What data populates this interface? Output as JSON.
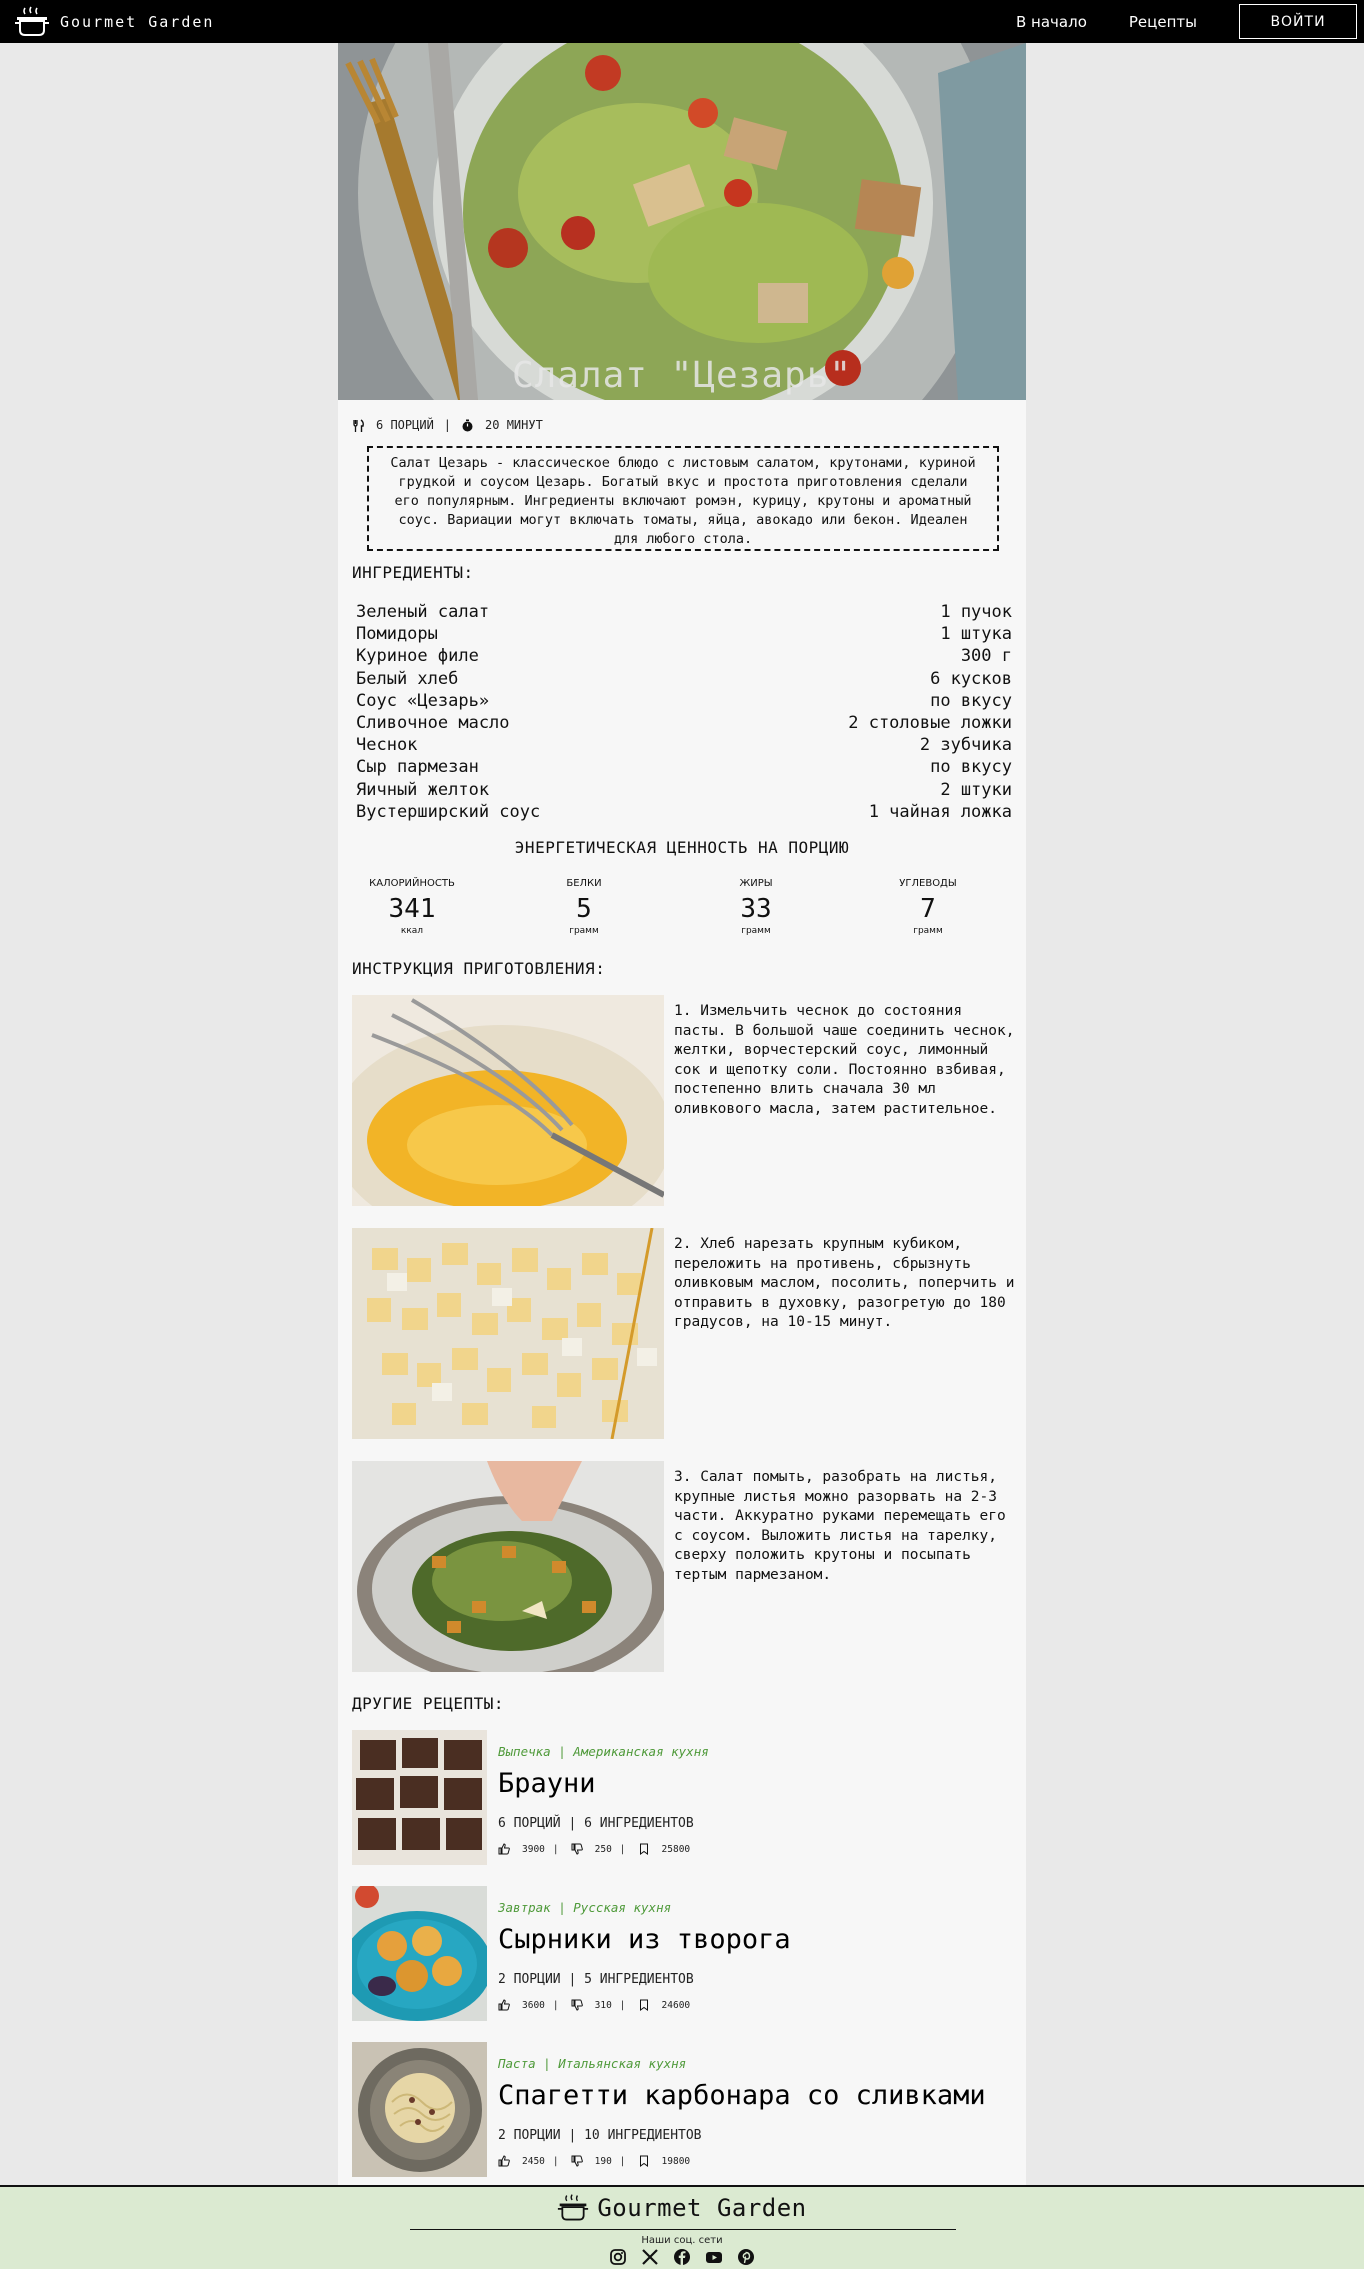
{
  "header": {
    "brand": "Gourmet Garden",
    "nav": [
      {
        "label": "В начало"
      },
      {
        "label": "Рецепты"
      }
    ],
    "login": "ВОЙТИ"
  },
  "recipe": {
    "title": "Слалат \"Цезарь\"",
    "servings": "6 ПОРЦИЙ",
    "separator": "|",
    "time": "20 МИНУТ",
    "description": "Салат Цезарь - классическое блюдо с листовым салатом, крутонами, куриной грудкой и соусом Цезарь. Богатый вкус и простота приготовления сделали его популярным. Ингредиенты включают ромэн, курицу, крутоны и ароматный соус. Вариации могут включать томаты, яйца, авокадо или бекон. Идеален для любого стола."
  },
  "ingredients_heading": "ИНГРЕДИЕНТЫ:",
  "ingredients": [
    {
      "name": "Зеленый салат",
      "amount": "1 пучок"
    },
    {
      "name": "Помидоры",
      "amount": "1 штука"
    },
    {
      "name": "Куриное филе",
      "amount": "300 г"
    },
    {
      "name": "Белый хлеб",
      "amount": "6 кусков"
    },
    {
      "name": "Соус «Цезарь»",
      "amount": "по вкусу"
    },
    {
      "name": "Сливочное масло",
      "amount": "2 столовые ложки"
    },
    {
      "name": "Чеснок",
      "amount": "2 зубчика"
    },
    {
      "name": "Сыр пармезан",
      "amount": "по вкусу"
    },
    {
      "name": "Яичный желток",
      "amount": "2 штуки"
    },
    {
      "name": "Вустерширский соус",
      "amount": "1 чайная ложка"
    }
  ],
  "nutrition": {
    "title": "ЭНЕРГЕТИЧЕСКАЯ ЦЕННОСТЬ НА ПОРЦИЮ",
    "items": [
      {
        "label": "КАЛОРИЙНОСТЬ",
        "value": "341",
        "unit": "ккал"
      },
      {
        "label": "БЕЛКИ",
        "value": "5",
        "unit": "грамм"
      },
      {
        "label": "ЖИРЫ",
        "value": "33",
        "unit": "грамм"
      },
      {
        "label": "УГЛЕВОДЫ",
        "value": "7",
        "unit": "грамм"
      }
    ]
  },
  "instructions_heading": "ИНСТРУКЦИЯ ПРИГОТОВЛЕНИЯ:",
  "steps": [
    {
      "text": "1. Измельчить чеснок до состояния пасты. В большой чаше соединить чеснок, желтки, ворчестерский соус, лимонный сок и щепотку соли. Постоянно взбивая, постепенно влить сначала 30 мл оливкового масла, затем растительное."
    },
    {
      "text": "2. Хлеб нарезать крупным кубиком, переложить на противень, сбрызнуть оливковым маслом, посолить, поперчить и отправить в духовку, разогретую до 180 градусов, на 10-15 минут."
    },
    {
      "text": "3. Салат помыть, разобрать на листья, крупные листья можно разорвать на 2-3 части. Аккуратно руками перемещать его с соусом. Выложить листья на тарелку, сверху положить крутоны и посыпать тертым пармезаном."
    }
  ],
  "other_heading": "ДРУГИЕ РЕЦЕПТЫ:",
  "other_recipes": [
    {
      "category": "Выпечка",
      "cuisine": "Американская кухня",
      "name": "Брауни",
      "servings": "6 ПОРЦИЙ",
      "ingredients": "6 ИНГРЕДИЕНТОВ",
      "likes": "3900",
      "dislikes": "250",
      "saves": "25800"
    },
    {
      "category": "Завтрак",
      "cuisine": "Русская кухня",
      "name": "Сырники из творога",
      "servings": "2 ПОРЦИИ",
      "ingredients": "5 ИНГРЕДИЕНТОВ",
      "likes": "3600",
      "dislikes": "310",
      "saves": "24600"
    },
    {
      "category": "Паста",
      "cuisine": "Итальянская кухня",
      "name": "Спагетти карбонара со сливками",
      "servings": "2 ПОРЦИИ",
      "ingredients": "10 ИНГРЕДИЕНТОВ",
      "likes": "2450",
      "dislikes": "190",
      "saves": "19800"
    }
  ],
  "footer": {
    "brand": "Gourmet Garden",
    "social_label": "Наши соц. сети",
    "social": [
      "instagram-icon",
      "x-icon",
      "facebook-icon",
      "youtube-icon",
      "pinterest-icon"
    ]
  },
  "colors": {
    "header_bg": "#000000",
    "footer_bg": "#dbead1",
    "tag_green": "#4f9a3a",
    "page_bg": "#e9e9e9"
  }
}
